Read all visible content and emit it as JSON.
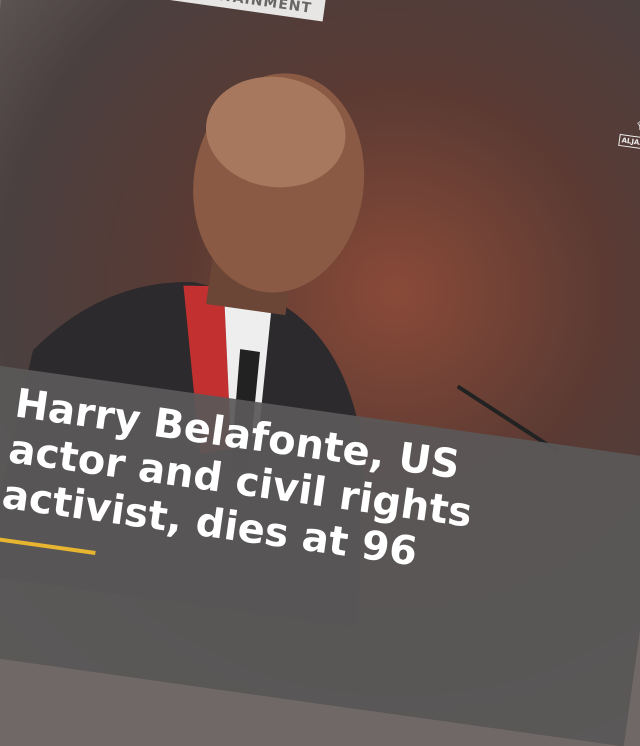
{
  "category": {
    "label": "ENTERTAINMENT",
    "icon": "star-icon",
    "color": "#e8b530"
  },
  "logo": {
    "text": "ALJAZEERA"
  },
  "headline": "Harry Belafonte, US actor and civil rights activist, dies at 96",
  "accent": "#e8b530"
}
